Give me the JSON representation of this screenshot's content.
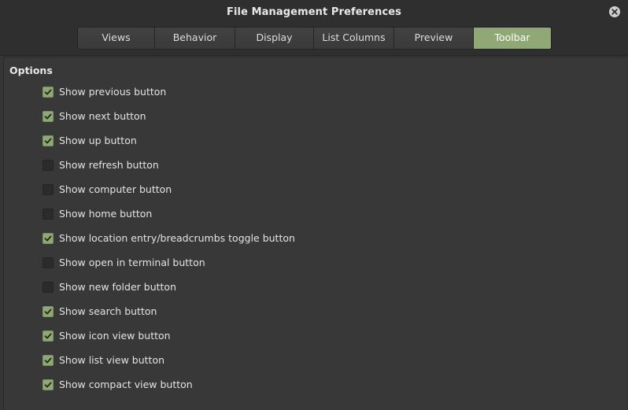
{
  "window": {
    "title": "File Management Preferences"
  },
  "tabs": [
    {
      "label": "Views",
      "active": false
    },
    {
      "label": "Behavior",
      "active": false
    },
    {
      "label": "Display",
      "active": false
    },
    {
      "label": "List Columns",
      "active": false
    },
    {
      "label": "Preview",
      "active": false
    },
    {
      "label": "Toolbar",
      "active": true
    }
  ],
  "section": {
    "title": "Options"
  },
  "options": [
    {
      "label": "Show previous button",
      "checked": true
    },
    {
      "label": "Show next button",
      "checked": true
    },
    {
      "label": "Show up button",
      "checked": true
    },
    {
      "label": "Show refresh button",
      "checked": false
    },
    {
      "label": "Show computer button",
      "checked": false
    },
    {
      "label": "Show home button",
      "checked": false
    },
    {
      "label": "Show location entry/breadcrumbs toggle button",
      "checked": true
    },
    {
      "label": "Show open in terminal button",
      "checked": false
    },
    {
      "label": "Show new folder button",
      "checked": false
    },
    {
      "label": "Show search button",
      "checked": true
    },
    {
      "label": "Show icon view button",
      "checked": true
    },
    {
      "label": "Show list view button",
      "checked": true
    },
    {
      "label": "Show compact view button",
      "checked": true
    }
  ],
  "icons": {
    "close": "close-icon",
    "check": "checkmark-icon"
  },
  "colors": {
    "accent": "#8fa876",
    "background": "#363636",
    "titlebar": "#2f2f2f"
  }
}
